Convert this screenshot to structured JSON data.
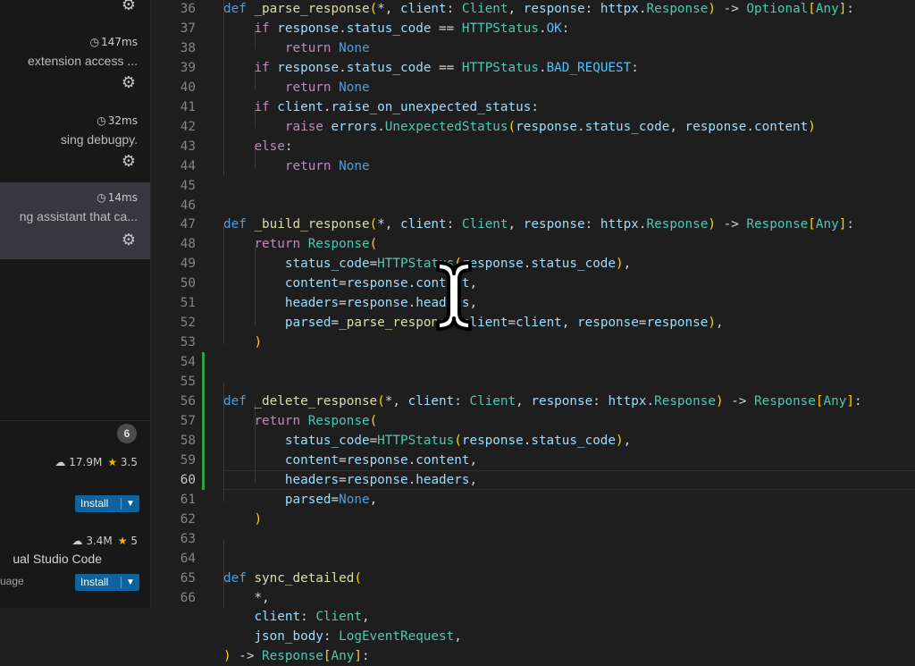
{
  "sidebar": {
    "items": [
      {
        "timing": "147ms",
        "description": "extension access ..."
      },
      {
        "timing": "32ms",
        "description": "sing debugpy."
      },
      {
        "timing": "14ms",
        "description": "ng assistant that ca..."
      }
    ],
    "installed_count": "6",
    "marketplace": [
      {
        "downloads": "17.9M",
        "rating": "3.5",
        "install_label": "Install"
      },
      {
        "downloads": "3.4M",
        "rating": "5",
        "name": "ual Studio Code",
        "subtitle": "uage",
        "install_label": "Install"
      }
    ]
  },
  "editor": {
    "line_numbers": [
      "36",
      "37",
      "38",
      "39",
      "40",
      "41",
      "42",
      "43",
      "44",
      "45",
      "46",
      "47",
      "48",
      "49",
      "50",
      "51",
      "52",
      "53",
      "54",
      "55",
      "56",
      "57",
      "58",
      "59",
      "60",
      "61",
      "62",
      "63",
      "64",
      "65",
      "66"
    ],
    "active_line": "60",
    "lines": [
      "def _parse_response(*, client: Client, response: httpx.Response) -> Optional[Any]:",
      "    if response.status_code == HTTPStatus.OK:",
      "        return None",
      "    if response.status_code == HTTPStatus.BAD_REQUEST:",
      "        return None",
      "    if client.raise_on_unexpected_status:",
      "        raise errors.UnexpectedStatus(response.status_code, response.content)",
      "    else:",
      "        return None",
      "",
      "",
      "def _build_response(*, client: Client, response: httpx.Response) -> Response[Any]:",
      "    return Response(",
      "        status_code=HTTPStatus(response.status_code),",
      "        content=response.content,",
      "        headers=response.headers,",
      "        parsed=_parse_response(client=client, response=response),",
      "    )",
      "",
      "",
      "def _delete_response(*, client: Client, response: httpx.Response) -> Response[Any]:",
      "    return Response(",
      "        status_code=HTTPStatus(response.status_code),",
      "        content=response.content,",
      "        headers=response.headers,",
      "        parsed=None,",
      "    )",
      "",
      "",
      "def sync_detailed(",
      "    *,",
      "    client: Client,",
      "    json_body: LogEventRequest,",
      ") -> Response[Any]:"
    ]
  },
  "colors": {
    "editor_bg": "#1e1e1e",
    "sidebar_bg": "#181818",
    "selected_item_bg": "#37373d",
    "install_button": "#0e639c",
    "keyword": "#569cd6",
    "function": "#dcdcaa",
    "class": "#4ec9b0",
    "variable": "#9cdcfe",
    "modified_gutter": "#2ea043"
  },
  "icons": [
    "gear-icon",
    "clock-icon",
    "cloud-download-icon",
    "star-icon",
    "chevron-down-icon",
    "text-cursor-icon"
  ]
}
